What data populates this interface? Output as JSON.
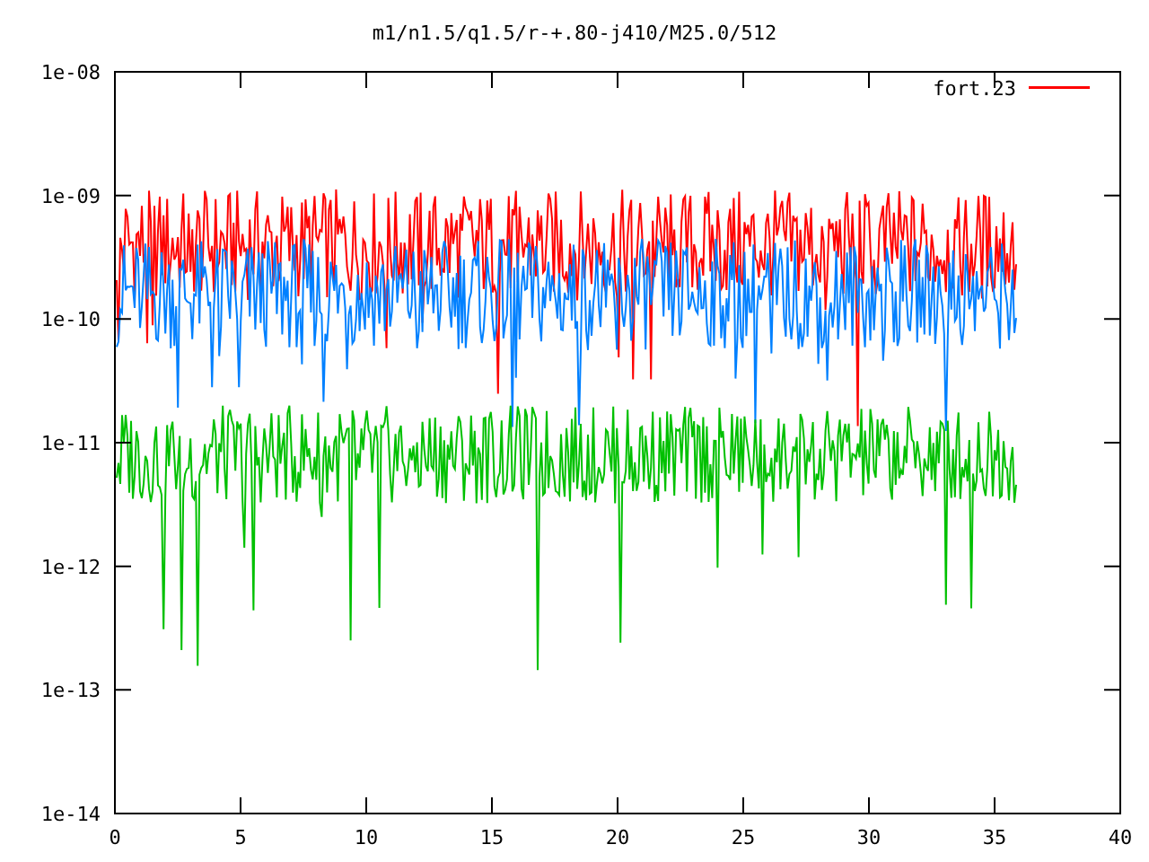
{
  "plot": {
    "title": "m1/n1.5/q1.5/r-+.80-j410/M25.0/512",
    "legend": [
      {
        "label": "fort.23",
        "color": "#ff0000"
      }
    ],
    "y_axis_labels": [
      "1e-08",
      "1e-09",
      "1e-10",
      "1e-11",
      "1e-12",
      "1e-13",
      "1e-14"
    ],
    "x_axis_labels": [
      "0",
      "5",
      "10",
      "15",
      "20",
      "25",
      "30",
      "35",
      "40"
    ]
  }
}
